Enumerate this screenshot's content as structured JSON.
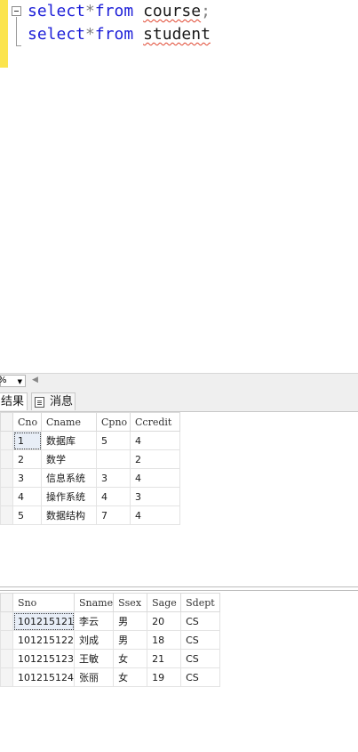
{
  "editor": {
    "line1": {
      "keyword1": "select",
      "op": "*",
      "keyword2": "from",
      "table": "course",
      "terminator": ";"
    },
    "line2": {
      "keyword1": "select",
      "op": "*",
      "keyword2": "from",
      "table": "student"
    }
  },
  "zoom": {
    "value": "%"
  },
  "tabs": {
    "results": "结果",
    "messages": "消息"
  },
  "course_grid": {
    "columns": [
      "Cno",
      "Cname",
      "Cpno",
      "Ccredit"
    ],
    "rows": [
      [
        "1",
        "数据库",
        "5",
        "4"
      ],
      [
        "2",
        "数学",
        "",
        "2"
      ],
      [
        "3",
        "信息系统",
        "3",
        "4"
      ],
      [
        "4",
        "操作系统",
        "4",
        "3"
      ],
      [
        "5",
        "数据结构",
        "7",
        "4"
      ]
    ]
  },
  "student_grid": {
    "columns": [
      "Sno",
      "Sname",
      "Ssex",
      "Sage",
      "Sdept"
    ],
    "rows": [
      [
        "101215121",
        "李云",
        "男",
        "20",
        "CS"
      ],
      [
        "101215122",
        "刘成",
        "男",
        "18",
        "CS"
      ],
      [
        "101215123",
        "王敏",
        "女",
        "21",
        "CS"
      ],
      [
        "101215124",
        "张丽",
        "女",
        "19",
        "CS"
      ]
    ]
  },
  "colors": {
    "keyword": "#1d1fd8",
    "change_margin": "#fbe44d",
    "squiggle": "#e0452f"
  }
}
